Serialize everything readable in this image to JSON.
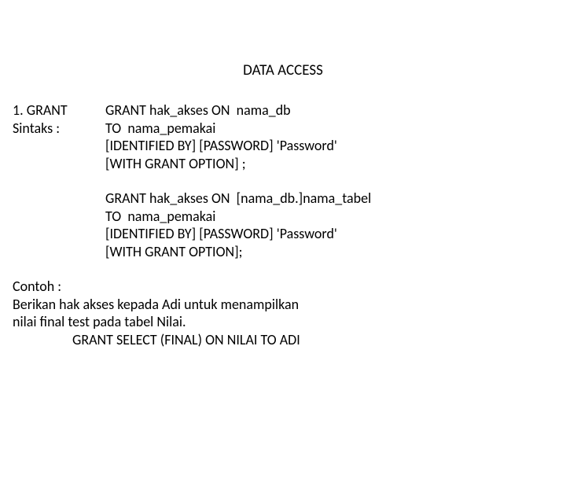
{
  "title": "DATA ACCESS",
  "item": {
    "number": "1.  GRANT",
    "label": "Sintaks :",
    "block1": {
      "l1": "GRANT hak_akses ON  nama_db",
      "l2": "TO  nama_pemakai",
      "l3": "[IDENTIFIED BY] [PASSWORD] 'Password'",
      "l4": "[WITH GRANT OPTION] ;"
    },
    "block2": {
      "l1": "GRANT hak_akses ON  [nama_db.]nama_tabel",
      "l2": "TO  nama_pemakai",
      "l3": "[IDENTIFIED BY] [PASSWORD] 'Password'",
      "l4": "[WITH GRANT OPTION];"
    }
  },
  "contoh": {
    "label": "Contoh :",
    "l1": "Berikan hak akses kepada Adi untuk menampilkan",
    "l2": "nilai final test pada tabel Nilai.",
    "l3": "GRANT SELECT (FINAL) ON NILAI TO ADI"
  }
}
